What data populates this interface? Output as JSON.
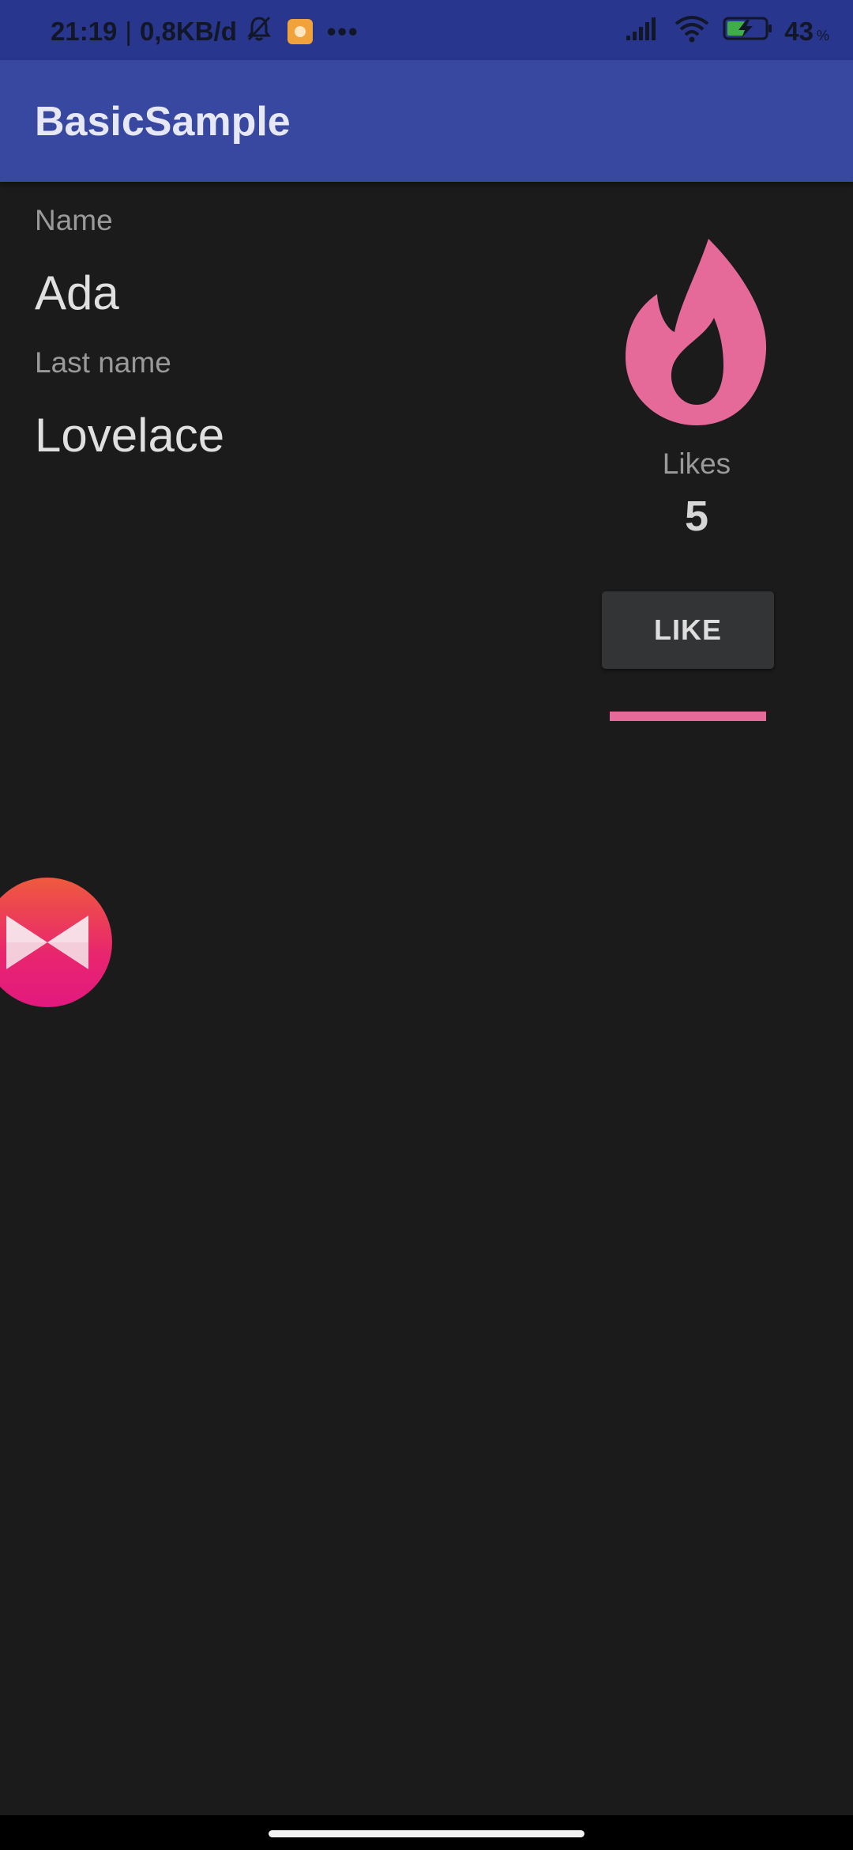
{
  "status_bar": {
    "time": "21:19",
    "separator": "|",
    "net_speed": "0,8KB/d",
    "more": "•••",
    "battery_percent": "43",
    "battery_unit": "%",
    "icons": [
      "bell-muted-icon",
      "app-notification-icon",
      "signal-icon",
      "wifi-icon",
      "battery-charging-icon"
    ]
  },
  "app_bar": {
    "title": "BasicSample"
  },
  "profile": {
    "name_label": "Name",
    "name_value": "Ada",
    "lastname_label": "Last name",
    "lastname_value": "Lovelace"
  },
  "likes": {
    "label": "Likes",
    "count": "5",
    "button_label": "LIKE",
    "progress_fraction": 1.0,
    "accent_color": "#e66a99"
  },
  "floating_bubble": {
    "icon": "bowtie-app-icon"
  }
}
